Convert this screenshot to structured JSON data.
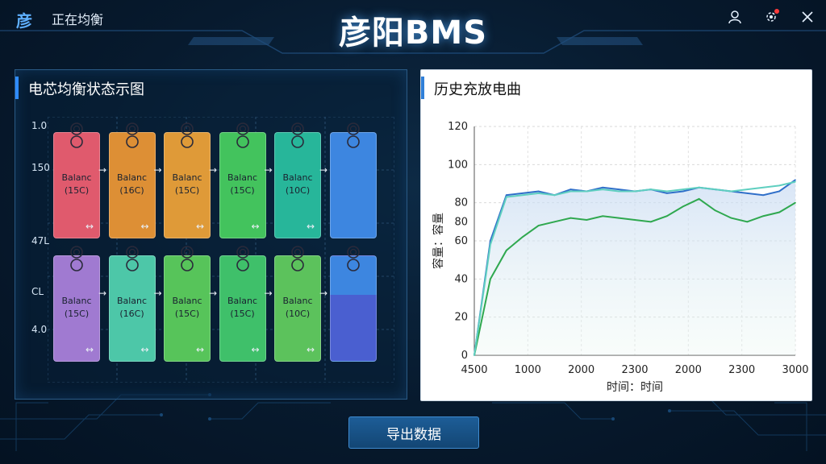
{
  "header": {
    "brand_glyph": "彦",
    "status": "正在均衡",
    "title": "彦阳BMS"
  },
  "left_panel": {
    "title": "电芯均衡状态示图",
    "y_labels": [
      "1.0",
      "150",
      "47L",
      "CL",
      "4.0"
    ],
    "cells": [
      {
        "label": "Balanc",
        "sub": "(15C)",
        "color": "#e05a6d"
      },
      {
        "label": "Balanc",
        "sub": "(16C)",
        "color": "#dd8f35"
      },
      {
        "label": "Balanc",
        "sub": "(15C)",
        "color": "#df9a38"
      },
      {
        "label": "Balanc",
        "sub": "(15C)",
        "color": "#43c35d"
      },
      {
        "label": "Balanc",
        "sub": "(10C)",
        "color": "#27b69a"
      },
      {
        "label": "",
        "sub": "",
        "color": "#3d86e0"
      },
      {
        "label": "Balanc",
        "sub": "(15C)",
        "color": "#a07ad1"
      },
      {
        "label": "Balanc",
        "sub": "(16C)",
        "color": "#4dc7a8"
      },
      {
        "label": "Balanc",
        "sub": "(15C)",
        "color": "#57c45a"
      },
      {
        "label": "Balanc",
        "sub": "(15C)",
        "color": "#3fc06a"
      },
      {
        "label": "Balanc",
        "sub": "(10C)",
        "color": "#5cc25c"
      },
      {
        "label": "",
        "sub": "",
        "color": "#3f6fd8"
      }
    ]
  },
  "right_panel": {
    "title": "历史充放电曲"
  },
  "chart_data": {
    "type": "line",
    "xlabel": "时间：时间",
    "ylabel": "容量：容量",
    "x_tick_labels": [
      "4500",
      "1000",
      "2000",
      "2300",
      "2000",
      "2300",
      "3000"
    ],
    "ylim": [
      0,
      120
    ],
    "y_ticks": [
      0,
      20,
      40,
      60,
      80,
      80,
      100,
      120
    ],
    "x": [
      0,
      0.3,
      0.6,
      0.9,
      1.2,
      1.5,
      1.8,
      2.1,
      2.4,
      2.7,
      3.0,
      3.3,
      3.6,
      3.9,
      4.2,
      4.5,
      4.8,
      5.1,
      5.4,
      5.7,
      6.0
    ],
    "series": [
      {
        "color": "#2f6fc9",
        "values": [
          0,
          60,
          84,
          85,
          86,
          84,
          87,
          86,
          88,
          87,
          86,
          87,
          85,
          86,
          88,
          87,
          86,
          85,
          84,
          86,
          92
        ]
      },
      {
        "color": "#2fa84f",
        "values": [
          0,
          40,
          55,
          62,
          68,
          70,
          72,
          71,
          73,
          72,
          71,
          70,
          73,
          78,
          82,
          76,
          72,
          70,
          73,
          75,
          80
        ]
      },
      {
        "color": "#5fcfc0",
        "values": [
          0,
          58,
          83,
          84,
          85,
          84,
          86,
          86,
          87,
          86,
          86,
          87,
          86,
          87,
          88,
          87,
          86,
          87,
          88,
          89,
          91
        ]
      }
    ]
  },
  "footer": {
    "export_label": "导出数据"
  }
}
